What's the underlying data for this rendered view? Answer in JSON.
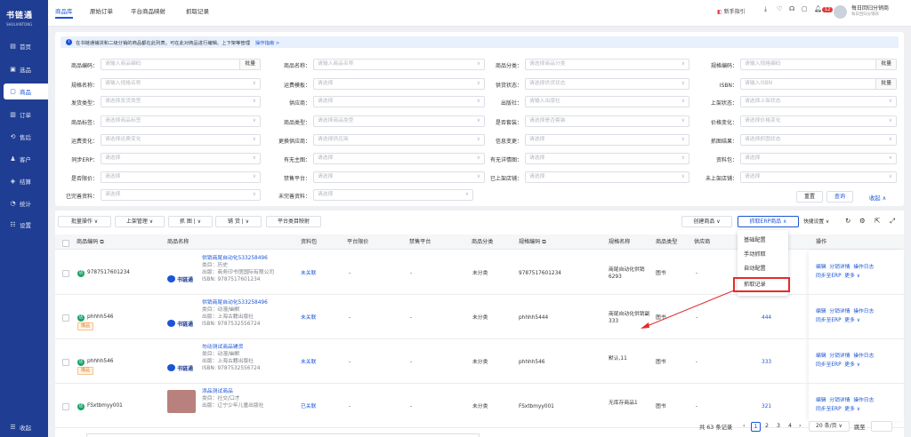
{
  "app": {
    "logo": "书链通",
    "logo_sub": "SHULIANTONG"
  },
  "sidebar": [
    {
      "icon": "▤",
      "label": "首页"
    },
    {
      "icon": "▣",
      "label": "选品"
    },
    {
      "icon": "▢",
      "label": "商品"
    },
    {
      "icon": "▥",
      "label": "订单"
    },
    {
      "icon": "⟲",
      "label": "售后"
    },
    {
      "icon": "♟",
      "label": "客户"
    },
    {
      "icon": "◈",
      "label": "结算"
    },
    {
      "icon": "◔",
      "label": "统计"
    },
    {
      "icon": "☷",
      "label": "设置"
    }
  ],
  "sidebar_bottom": "收起",
  "tabs": [
    "商品库",
    "原始订单",
    "平台商品映射",
    "抓取记录"
  ],
  "topbar": {
    "guide": "新手指引",
    "badge": "12",
    "user": "每日回归分销商",
    "user_sub": "每日回归分销商"
  },
  "notice": {
    "text": "在书链通铺货和二级分销的商品都在此列表。可在此对商品进行编辑、上下架等管理",
    "link": "操作指南 >"
  },
  "filters": [
    {
      "label": "商品编码：",
      "ph": "请输入商品编码",
      "bulk": "批量"
    },
    {
      "label": "商品名称：",
      "ph": "请输入商品名称"
    },
    {
      "label": "商品分类：",
      "ph": "请选择商品分类"
    },
    {
      "label": "规格编码：",
      "ph": "请输入规格编码",
      "bulk": "批量"
    },
    {
      "label": "规格名称：",
      "ph": "请输入规格名称"
    },
    {
      "label": "运费模板：",
      "ph": "请选择"
    },
    {
      "label": "供货状态：",
      "ph": "请选择供货状态"
    },
    {
      "label": "ISBN：",
      "ph": "请输入ISBN",
      "bulk": "批量"
    },
    {
      "label": "发货类型：",
      "ph": "请选择发货类型"
    },
    {
      "label": "供应商：",
      "ph": "请选择"
    },
    {
      "label": "出版社：",
      "ph": "请输入出版社"
    },
    {
      "label": "上架状态：",
      "ph": "请选择上架状态"
    },
    {
      "label": "商品标签：",
      "ph": "请选择商品标签"
    },
    {
      "label": "商品类型：",
      "ph": "请选择商品类型"
    },
    {
      "label": "是否套装：",
      "ph": "请选择是否套装"
    },
    {
      "label": "价格变化：",
      "ph": "请选择价格变化"
    },
    {
      "label": "运费变化：",
      "ph": "请选择运费变化"
    },
    {
      "label": "更换供应商：",
      "ph": "请选择供应商"
    },
    {
      "label": "信息变更：",
      "ph": "请选择"
    },
    {
      "label": "抓图结果：",
      "ph": "请选择抓图状态"
    },
    {
      "label": "同步ERP：",
      "ph": "请选择"
    },
    {
      "label": "有无主图：",
      "ph": "请选择"
    },
    {
      "label": "有无详情图：",
      "ph": "请选择"
    },
    {
      "label": "资料包：",
      "ph": "请选择"
    },
    {
      "label": "是否限价：",
      "ph": "请选择"
    },
    {
      "label": "禁售平台：",
      "ph": "请选择"
    },
    {
      "label": "已上架店铺：",
      "ph": "请选择"
    },
    {
      "label": "未上架店铺：",
      "ph": "请选择"
    },
    {
      "label": "已完善资料：",
      "ph": "请选择"
    },
    {
      "label": "未完善资料：",
      "ph": "请选择"
    }
  ],
  "filter_actions": {
    "reset": "重置",
    "query": "查询",
    "collapse": "收起 ∧"
  },
  "toolbar": {
    "batch": "批量操作",
    "shelf": "上架管理",
    "grab": "抓 图",
    "fill": "铺 货",
    "map": "平台类目映射",
    "create": "创建商品",
    "erp": "抓取ERP商品",
    "quick": "快捷设置"
  },
  "table": {
    "headers": [
      "商品编码",
      "商品名称",
      "资料包",
      "平台限价",
      "禁售平台",
      "商品分类",
      "规格编码",
      "规格名称",
      "商品类型",
      "供应商",
      "操作"
    ]
  },
  "rows": [
    {
      "shop": "9787517601234",
      "name": "供销商尾自动化533258496",
      "cat": "类目：历史",
      "pub": "出版：商务印书馆国际有限公司",
      "isbn": "ISBN: 9787517601234",
      "pack": "未关联",
      "lim": "-",
      "ban": "-",
      "cls": "未分类",
      "sku": "9787517601234",
      "spec": "商尾自动化供销6293",
      "type": "图书",
      "sup": "-",
      "stock": "",
      "tag": ""
    },
    {
      "shop": "phhhh546",
      "name": "供销商尾自动化533258496",
      "cat": "类目：动漫/幽默",
      "pub": "出版：上海古籍出版社",
      "isbn": "ISBN: 9787532556724",
      "pack": "未关联",
      "lim": "-",
      "ban": "-",
      "cls": "未分类",
      "sku": "phhhh5444",
      "spec": "商尾自动化供销副333",
      "type": "图书",
      "sup": "-",
      "stock": "444",
      "tag": "爆品"
    },
    {
      "shop": "phhhh546",
      "name": "勿动测试商品铺货",
      "cat": "类目：动漫/幽默",
      "pub": "出版：上海古籍出版社",
      "isbn": "ISBN: 9787532556724",
      "pack": "未关联",
      "lim": "-",
      "ban": "-",
      "cls": "未分类",
      "sku": "phhhh546",
      "spec": "默认,11",
      "type": "图书",
      "sup": "-",
      "stock": "333",
      "tag": "爆品"
    },
    {
      "shop": "FSxtbmyy001",
      "name": "添品测试商品",
      "cat": "类目：社交/口才",
      "pub": "出版：辽宁少年儿童出版社",
      "isbn": "",
      "pack": "已关联",
      "lim": "-",
      "ban": "-",
      "cls": "未分类",
      "sku": "FSxtbmyy001",
      "spec": "无库存商品1",
      "type": "图书",
      "sup": "-",
      "stock": "321",
      "tag": ""
    }
  ],
  "ops": {
    "edit": "编辑",
    "dist": "分销详情",
    "log": "操作日志",
    "sync": "同步至ERP",
    "more": "更多"
  },
  "dropdown": [
    "基础配置",
    "手动抓取",
    "自动配置",
    "抓取记录"
  ],
  "pagination": {
    "total": "共 63 条记录",
    "pages": [
      "1",
      "2",
      "3",
      "4"
    ],
    "size": "20 条/页",
    "goto": "跳至"
  }
}
